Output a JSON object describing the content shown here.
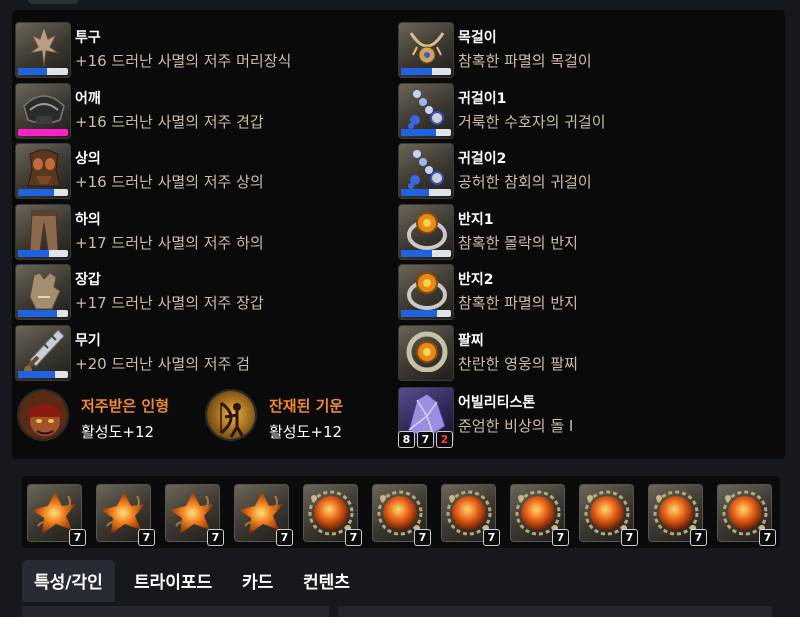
{
  "equipment_left": [
    {
      "slot": "투구",
      "item": "+16 드러난 사멸의 저주 머리장식",
      "quality": 0.58,
      "quality_color": "#1f63e0",
      "icon": "helmet-icon"
    },
    {
      "slot": "어깨",
      "item": "+16 드러난 사멸의 저주 견갑",
      "quality": 1.0,
      "quality_color": "#ff1fc9",
      "icon": "shoulder-icon"
    },
    {
      "slot": "상의",
      "item": "+16 드러난 사멸의 저주 상의",
      "quality": 0.72,
      "quality_color": "#1f63e0",
      "icon": "chest-armor-icon"
    },
    {
      "slot": "하의",
      "item": "+17 드러난 사멸의 저주 하의",
      "quality": 0.62,
      "quality_color": "#1f63e0",
      "icon": "pants-icon"
    },
    {
      "slot": "장갑",
      "item": "+17 드러난 사멸의 저주 장갑",
      "quality": 0.78,
      "quality_color": "#1f63e0",
      "icon": "gloves-icon"
    },
    {
      "slot": "무기",
      "item": "+20 드러난 사멸의 저주 검",
      "quality": 0.73,
      "quality_color": "#1f63e0",
      "icon": "sword-icon"
    }
  ],
  "equipment_right": [
    {
      "slot": "목걸이",
      "item": "참혹한 파멸의 목걸이",
      "quality": 0.62,
      "quality_color": "#1f63e0",
      "icon": "necklace-icon"
    },
    {
      "slot": "귀걸이1",
      "item": "거룩한 수호자의 귀걸이",
      "quality": 0.7,
      "quality_color": "#1f63e0",
      "icon": "earring-icon"
    },
    {
      "slot": "귀걸이2",
      "item": "공허한 참회의 귀걸이",
      "quality": 0.55,
      "quality_color": "#1f63e0",
      "icon": "earring-icon"
    },
    {
      "slot": "반지1",
      "item": "참혹한 몰락의 반지",
      "quality": 0.62,
      "quality_color": "#1f63e0",
      "icon": "ring-icon"
    },
    {
      "slot": "반지2",
      "item": "참혹한 파멸의 반지",
      "quality": 0.72,
      "quality_color": "#1f63e0",
      "icon": "ring-icon"
    },
    {
      "slot": "팔찌",
      "item": "찬란한 영웅의 팔찌",
      "quality": null,
      "quality_color": "",
      "icon": "bracelet-icon"
    }
  ],
  "ability_stone": {
    "slot": "어빌리티스톤",
    "item": "준엄한 비상의 돌 I",
    "icon": "ability-stone-icon",
    "badges": [
      "8",
      "7",
      "2"
    ]
  },
  "engravings": [
    {
      "name": "저주받은 인형",
      "level": "활성도+12",
      "icon": "cursed-doll-icon"
    },
    {
      "name": "잔재된 기운",
      "level": "활성도+12",
      "icon": "remnant-energy-icon"
    }
  ],
  "gems": [
    {
      "type": "flame",
      "level": "7"
    },
    {
      "type": "flame",
      "level": "7"
    },
    {
      "type": "flame",
      "level": "7"
    },
    {
      "type": "flame",
      "level": "7"
    },
    {
      "type": "orb",
      "level": "7"
    },
    {
      "type": "orb",
      "level": "7"
    },
    {
      "type": "orb",
      "level": "7"
    },
    {
      "type": "orb",
      "level": "7"
    },
    {
      "type": "orb",
      "level": "7"
    },
    {
      "type": "orb",
      "level": "7"
    },
    {
      "type": "orb",
      "level": "7"
    }
  ],
  "tabs": [
    "특성/각인",
    "트라이포드",
    "카드",
    "컨텐츠"
  ],
  "active_tab": "특성/각인"
}
